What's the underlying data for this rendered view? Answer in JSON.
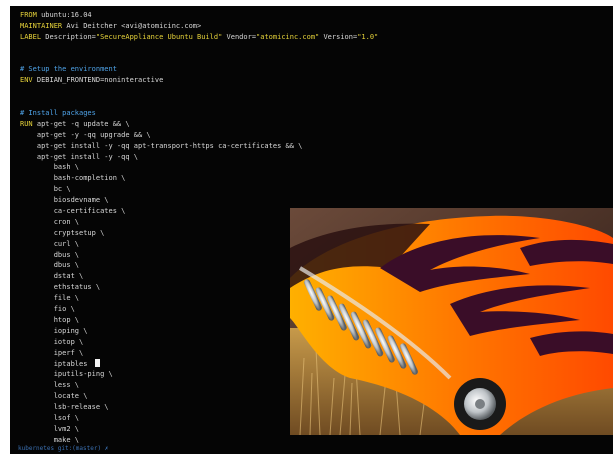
{
  "terminal": {
    "lines": [
      [
        {
          "t": "FROM ",
          "c": "kw"
        },
        {
          "t": "ubuntu:16.04",
          "c": "plain"
        }
      ],
      [
        {
          "t": "MAINTAINER ",
          "c": "kw"
        },
        {
          "t": "Avi Deitcher <avi@atomicinc.com>",
          "c": "plain"
        }
      ],
      [
        {
          "t": "LABEL ",
          "c": "kw"
        },
        {
          "t": "Description=",
          "c": "plain"
        },
        {
          "t": "\"SecureAppliance Ubuntu Build\"",
          "c": "str"
        },
        {
          "t": " Vendor=",
          "c": "plain"
        },
        {
          "t": "\"atomicinc.com\"",
          "c": "str"
        },
        {
          "t": " Version=",
          "c": "plain"
        },
        {
          "t": "\"1.0\"",
          "c": "str"
        }
      ],
      [],
      [],
      [
        {
          "t": "# Setup the environment",
          "c": "comment"
        }
      ],
      [
        {
          "t": "ENV ",
          "c": "kw"
        },
        {
          "t": "DEBIAN_FRONTEND=noninteractive",
          "c": "plain"
        }
      ],
      [],
      [],
      [
        {
          "t": "# Install packages",
          "c": "comment"
        }
      ],
      [
        {
          "t": "RUN ",
          "c": "kw"
        },
        {
          "t": "apt-get -q update && \\",
          "c": "plain"
        }
      ],
      [
        {
          "t": "    apt-get -y -qq upgrade && \\",
          "c": "plain"
        }
      ],
      [
        {
          "t": "    apt-get install -y -qq apt-transport-https ca-certificates && \\",
          "c": "plain"
        }
      ],
      [
        {
          "t": "    apt-get install -y -qq \\",
          "c": "plain"
        }
      ],
      [
        {
          "t": "        bash \\",
          "c": "plain"
        }
      ],
      [
        {
          "t": "        bash-completion \\",
          "c": "plain"
        }
      ],
      [
        {
          "t": "        bc \\",
          "c": "plain"
        }
      ],
      [
        {
          "t": "        biosdevname \\",
          "c": "plain"
        }
      ],
      [
        {
          "t": "        ca-certificates \\",
          "c": "plain"
        }
      ],
      [
        {
          "t": "        cron \\",
          "c": "plain"
        }
      ],
      [
        {
          "t": "        cryptsetup \\",
          "c": "plain"
        }
      ],
      [
        {
          "t": "        curl \\",
          "c": "plain"
        }
      ],
      [
        {
          "t": "        dbus \\",
          "c": "plain"
        }
      ],
      [
        {
          "t": "        dbus \\",
          "c": "plain"
        }
      ],
      [
        {
          "t": "        dstat \\",
          "c": "plain"
        }
      ],
      [
        {
          "t": "        ethstatus \\",
          "c": "plain"
        }
      ],
      [
        {
          "t": "        file \\",
          "c": "plain"
        }
      ],
      [
        {
          "t": "        fio \\",
          "c": "plain"
        }
      ],
      [
        {
          "t": "        htop \\",
          "c": "plain"
        }
      ],
      [
        {
          "t": "        ioping \\",
          "c": "plain"
        }
      ],
      [
        {
          "t": "        iotop \\",
          "c": "plain"
        }
      ],
      [
        {
          "t": "        iperf \\",
          "c": "plain"
        }
      ],
      [
        {
          "t": "        iptables ",
          "c": "plain"
        },
        {
          "cursor": true
        }
      ],
      [
        {
          "t": "        iputils-ping \\",
          "c": "plain"
        }
      ],
      [
        {
          "t": "        less \\",
          "c": "plain"
        }
      ],
      [
        {
          "t": "        locate \\",
          "c": "plain"
        }
      ],
      [
        {
          "t": "        lsb-release \\",
          "c": "plain"
        }
      ],
      [
        {
          "t": "        lsof \\",
          "c": "plain"
        }
      ],
      [
        {
          "t": "        lvm2 \\",
          "c": "plain"
        }
      ],
      [
        {
          "t": "        make \\",
          "c": "plain"
        }
      ]
    ],
    "status": "kubernetes git:(master) ✗"
  },
  "colors": {
    "keyword": "#e6d33a",
    "string": "#e6d33a",
    "comment": "#4fa3e8",
    "text": "#d8d8d8",
    "background": "#050505"
  },
  "photo": {
    "subject": "hot-rod-flames-photo"
  }
}
